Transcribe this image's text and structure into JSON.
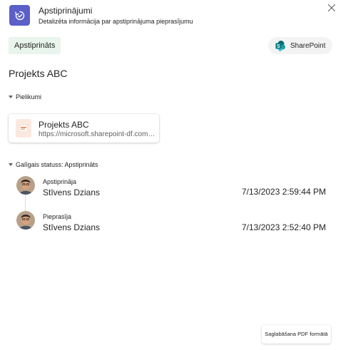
{
  "header": {
    "title": "Apstiprinājumi",
    "subtitle": "Detalizēta informācija par apstiprinājuma pieprasījumu",
    "app_icon": "approvals-icon",
    "close_icon": "close-icon"
  },
  "status_pill": "Apstiprināts",
  "sharepoint_button": {
    "label": "SharePoint",
    "icon": "sharepoint-icon"
  },
  "request_title": "Projekts ABC",
  "attachments": {
    "header": "Pielikumi",
    "items": [
      {
        "name": "Projekts ABC",
        "url": "https://microsoft.sharepoint-df.com/sites/projekts-abc",
        "icon": "powerpoint-file-icon"
      }
    ]
  },
  "final_status": {
    "header": "Galīgais statuss: Apstiprināts",
    "entries": [
      {
        "role": "Apstiprināja",
        "person": "Stīvens Dzians",
        "time": "7/13/2023 2:59:44 PM"
      },
      {
        "role": "Pieprasīja",
        "person": "Stīvens Dzians",
        "time": "7/13/2023 2:52:40 PM"
      }
    ]
  },
  "footer": {
    "save_pdf_label": "Saglabāšana PDF formātā"
  },
  "colors": {
    "accent": "#5b5fc7",
    "status_bg": "#e8f4ec",
    "sharepoint": "#038387"
  }
}
